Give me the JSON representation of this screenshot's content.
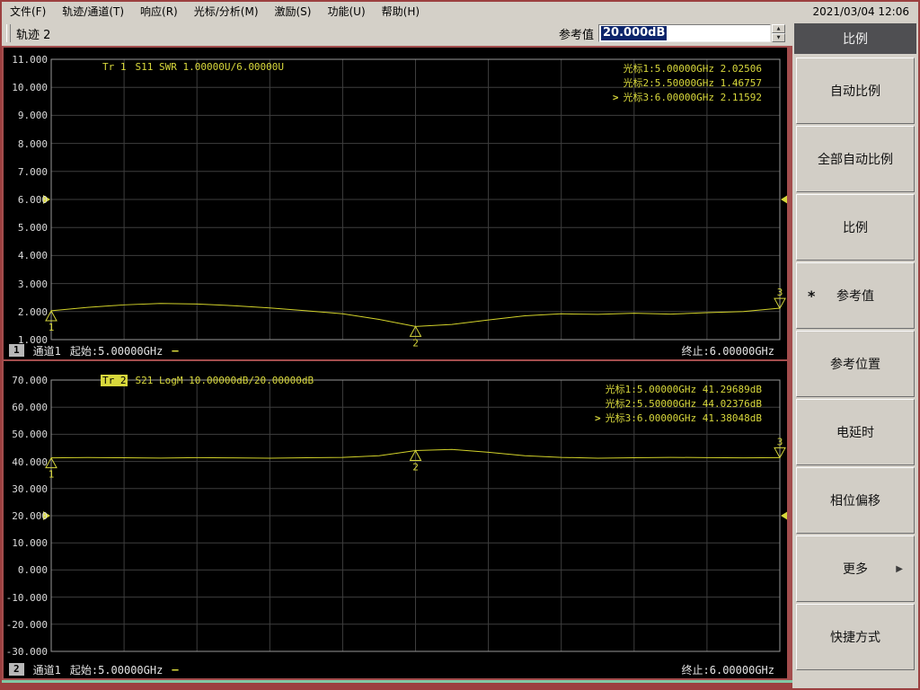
{
  "titlebar": {
    "datetime": "2021/03/04 12:06"
  },
  "menu": {
    "items": [
      "文件(F)",
      "轨迹/通道(T)",
      "响应(R)",
      "光标/分析(M)",
      "激励(S)",
      "功能(U)",
      "帮助(H)"
    ]
  },
  "toolbar": {
    "trace_title": "轨迹 2",
    "ref_label": "参考值",
    "ref_value": "20.000dB"
  },
  "glyphs": {
    "spin_up": "▲",
    "spin_down": "▼",
    "select_arrow": ">",
    "more_arrow": "▶",
    "active_star": "*"
  },
  "side_panel": {
    "header": "比例",
    "buttons": [
      {
        "label": "自动比例",
        "active": false,
        "submenu": false
      },
      {
        "label": "全部自动比例",
        "active": false,
        "submenu": false
      },
      {
        "label": "比例",
        "active": false,
        "submenu": false
      },
      {
        "label": "参考值",
        "active": true,
        "submenu": false
      },
      {
        "label": "参考位置",
        "active": false,
        "submenu": false
      },
      {
        "label": "电延时",
        "active": false,
        "submenu": false
      },
      {
        "label": "相位偏移",
        "active": false,
        "submenu": false
      },
      {
        "label": "更多",
        "active": false,
        "submenu": true
      },
      {
        "label": "快捷方式",
        "active": false,
        "submenu": false
      }
    ]
  },
  "plots": [
    {
      "trace_label": "Tr 1",
      "trace_active": false,
      "meas_label": "S11 SWR 1.00000U/6.00000U",
      "readouts": [
        {
          "text": "光标1:5.00000GHz 2.02506",
          "selected": false
        },
        {
          "text": "光标2:5.50000GHz 1.46757",
          "selected": false
        },
        {
          "text": "光标3:6.00000GHz 2.11592",
          "selected": true
        }
      ],
      "y_ticks": [
        "11.000",
        "10.000",
        "9.000",
        "8.000",
        "7.000",
        "6.000",
        "5.000",
        "4.000",
        "3.000",
        "2.000",
        "1.000"
      ],
      "status": {
        "badge": "1",
        "channel": "通道1",
        "start": "起始:5.00000GHz",
        "dash": "—",
        "stop": "终止:6.00000GHz"
      }
    },
    {
      "trace_label": "Tr 2",
      "trace_active": true,
      "meas_label": "S21 LogM 10.00000dB/20.00000dB",
      "readouts": [
        {
          "text": "光标1:5.00000GHz 41.29689dB",
          "selected": false
        },
        {
          "text": "光标2:5.50000GHz 44.02376dB",
          "selected": false
        },
        {
          "text": "光标3:6.00000GHz 41.38048dB",
          "selected": true
        }
      ],
      "y_ticks": [
        "70.000",
        "60.000",
        "50.000",
        "40.000",
        "30.000",
        "20.000",
        "10.000",
        "0.000",
        "-10.000",
        "-20.000",
        "-30.000"
      ],
      "status": {
        "badge": "2",
        "channel": "通道1",
        "start": "起始:5.00000GHz",
        "dash": "—",
        "stop": "终止:6.00000GHz"
      }
    }
  ],
  "chart_data": [
    {
      "type": "line",
      "name": "Tr 1 S11 SWR",
      "x_unit": "GHz",
      "x_range": [
        5.0,
        6.0
      ],
      "y_range": [
        1.0,
        11.0
      ],
      "y_per_div": 1.0,
      "ref_value": 6.0,
      "x": [
        5.0,
        5.05,
        5.1,
        5.15,
        5.2,
        5.25,
        5.3,
        5.35,
        5.4,
        5.45,
        5.5,
        5.55,
        5.6,
        5.65,
        5.7,
        5.75,
        5.8,
        5.85,
        5.9,
        5.95,
        6.0
      ],
      "y": [
        2.03,
        2.15,
        2.24,
        2.29,
        2.27,
        2.21,
        2.13,
        2.03,
        1.92,
        1.72,
        1.47,
        1.54,
        1.7,
        1.85,
        1.92,
        1.9,
        1.94,
        1.91,
        1.96,
        2.0,
        2.12
      ],
      "markers": [
        {
          "n": "1",
          "x": 5.0,
          "y": 2.02506,
          "dir": "up"
        },
        {
          "n": "2",
          "x": 5.5,
          "y": 1.46757,
          "dir": "up"
        },
        {
          "n": "3",
          "x": 6.0,
          "y": 2.11592,
          "dir": "down"
        }
      ]
    },
    {
      "type": "line",
      "name": "Tr 2 S21 LogM",
      "x_unit": "GHz",
      "x_range": [
        5.0,
        6.0
      ],
      "y_range": [
        -30.0,
        70.0
      ],
      "y_per_div": 10.0,
      "ref_value": 20.0,
      "x": [
        5.0,
        5.05,
        5.1,
        5.15,
        5.2,
        5.25,
        5.3,
        5.35,
        5.4,
        5.45,
        5.5,
        5.55,
        5.6,
        5.65,
        5.7,
        5.75,
        5.8,
        5.85,
        5.9,
        5.95,
        6.0
      ],
      "y": [
        41.3,
        41.45,
        41.35,
        41.25,
        41.4,
        41.3,
        41.2,
        41.35,
        41.5,
        42.1,
        44.02,
        44.4,
        43.4,
        42.1,
        41.5,
        41.2,
        41.35,
        41.5,
        41.4,
        41.3,
        41.38
      ],
      "markers": [
        {
          "n": "1",
          "x": 5.0,
          "y": 41.29689,
          "dir": "up"
        },
        {
          "n": "2",
          "x": 5.5,
          "y": 44.02376,
          "dir": "up"
        },
        {
          "n": "3",
          "x": 6.0,
          "y": 41.38048,
          "dir": "down"
        }
      ]
    }
  ],
  "colors": {
    "trace": "#d2d22a",
    "marker_text": "#d8d83c",
    "grid": "#3e3e3e",
    "grid_border": "#989898",
    "frame_red": "#a34d4d",
    "accent_green": "#82c9a5",
    "selection_blue": "#0b246a",
    "panel_gray": "#d4d0c8"
  }
}
